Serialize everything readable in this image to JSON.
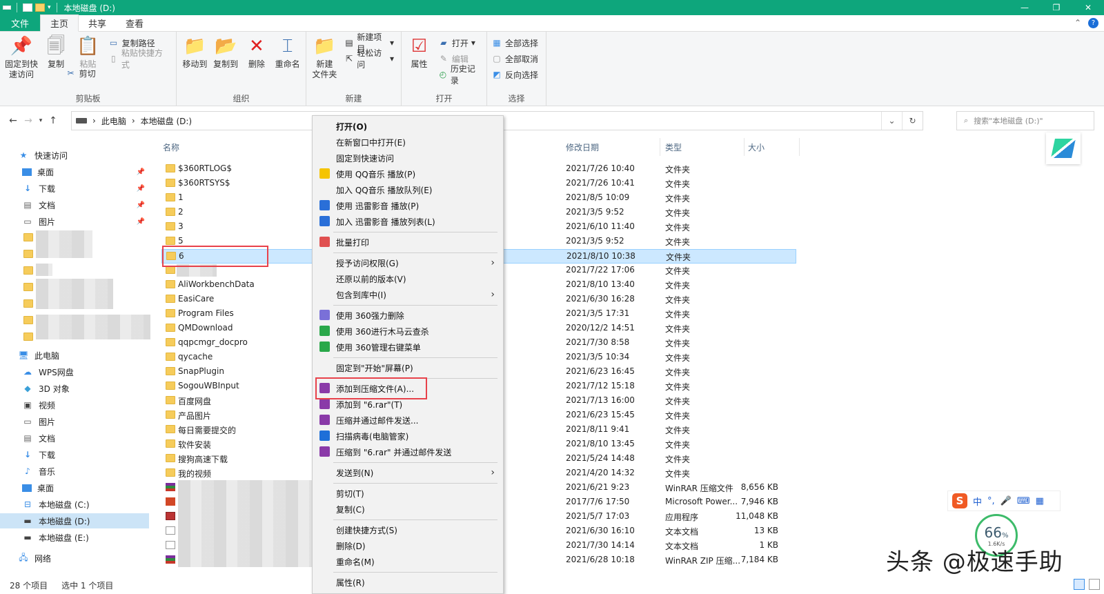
{
  "window": {
    "title": "本地磁盘 (D:)"
  },
  "ribbon_tabs": [
    "文件",
    "主页",
    "共享",
    "查看"
  ],
  "ribbon": {
    "clipboard": {
      "label": "剪贴板",
      "pin": "固定到快\n速访问",
      "copy": "复制",
      "paste": "粘贴",
      "copy_path": "复制路径",
      "paste_shortcut": "粘贴快捷方式",
      "cut": "剪切"
    },
    "organize": {
      "label": "组织",
      "move_to": "移动到",
      "copy_to": "复制到",
      "delete": "删除",
      "rename": "重命名"
    },
    "new": {
      "label": "新建",
      "new_folder": "新建\n文件夹",
      "new_item": "新建项目",
      "easy_access": "轻松访问"
    },
    "open": {
      "label": "打开",
      "properties": "属性",
      "open": "打开",
      "edit": "编辑",
      "history": "历史记录"
    },
    "select": {
      "label": "选择",
      "select_all": "全部选择",
      "select_none": "全部取消",
      "invert": "反向选择"
    }
  },
  "address": {
    "crumbs": [
      "此电脑",
      "本地磁盘 (D:)"
    ],
    "search_placeholder": "搜索\"本地磁盘 (D:)\""
  },
  "sidebar": {
    "quick_access": "快速访问",
    "quick_items": [
      "桌面",
      "下载",
      "文档",
      "图片"
    ],
    "this_pc": "此电脑",
    "pc_items": [
      "WPS网盘",
      "3D 对象",
      "视频",
      "图片",
      "文档",
      "下载",
      "音乐",
      "桌面",
      "本地磁盘 (C:)",
      "本地磁盘 (D:)",
      "本地磁盘 (E:)"
    ],
    "network": "网络"
  },
  "columns": {
    "name": "名称",
    "date": "修改日期",
    "type": "类型",
    "size": "大小"
  },
  "files": [
    {
      "name": "$360RTLOG$",
      "date": "2021/7/26 10:40",
      "type": "文件夹",
      "size": "",
      "icon": "folder"
    },
    {
      "name": "$360RTSYS$",
      "date": "2021/7/26 10:41",
      "type": "文件夹",
      "size": "",
      "icon": "folder"
    },
    {
      "name": "1",
      "date": "2021/8/5 10:09",
      "type": "文件夹",
      "size": "",
      "icon": "folder"
    },
    {
      "name": "2",
      "date": "2021/3/5 9:52",
      "type": "文件夹",
      "size": "",
      "icon": "folder"
    },
    {
      "name": "3",
      "date": "2021/6/10 11:40",
      "type": "文件夹",
      "size": "",
      "icon": "folder"
    },
    {
      "name": "5",
      "date": "2021/3/5 9:52",
      "type": "文件夹",
      "size": "",
      "icon": "folder"
    },
    {
      "name": "6",
      "date": "2021/8/10 10:38",
      "type": "文件夹",
      "size": "",
      "icon": "folder"
    },
    {
      "name": "",
      "date": "2021/7/22 17:06",
      "type": "文件夹",
      "size": "",
      "icon": "folder"
    },
    {
      "name": "AliWorkbenchData",
      "date": "2021/8/10 13:40",
      "type": "文件夹",
      "size": "",
      "icon": "folder"
    },
    {
      "name": "EasiCare",
      "date": "2021/6/30 16:28",
      "type": "文件夹",
      "size": "",
      "icon": "folder"
    },
    {
      "name": "Program Files",
      "date": "2021/3/5 17:31",
      "type": "文件夹",
      "size": "",
      "icon": "folder"
    },
    {
      "name": "QMDownload",
      "date": "2020/12/2 14:51",
      "type": "文件夹",
      "size": "",
      "icon": "folder"
    },
    {
      "name": "qqpcmgr_docpro",
      "date": "2021/7/30 8:58",
      "type": "文件夹",
      "size": "",
      "icon": "folder"
    },
    {
      "name": "qycache",
      "date": "2021/3/5 10:34",
      "type": "文件夹",
      "size": "",
      "icon": "folder"
    },
    {
      "name": "SnapPlugin",
      "date": "2021/6/23 16:45",
      "type": "文件夹",
      "size": "",
      "icon": "folder"
    },
    {
      "name": "SogouWBInput",
      "date": "2021/7/12 15:18",
      "type": "文件夹",
      "size": "",
      "icon": "folder"
    },
    {
      "name": "百度网盘",
      "date": "2021/7/13 16:00",
      "type": "文件夹",
      "size": "",
      "icon": "folder"
    },
    {
      "name": "产品图片",
      "date": "2021/6/23 15:45",
      "type": "文件夹",
      "size": "",
      "icon": "folder"
    },
    {
      "name": "每日需要提交的",
      "date": "2021/8/11 9:41",
      "type": "文件夹",
      "size": "",
      "icon": "folder"
    },
    {
      "name": "软件安装",
      "date": "2021/8/10 13:45",
      "type": "文件夹",
      "size": "",
      "icon": "folder"
    },
    {
      "name": "搜狗高速下载",
      "date": "2021/5/24 14:48",
      "type": "文件夹",
      "size": "",
      "icon": "folder"
    },
    {
      "name": "我的视频",
      "date": "2021/4/20 14:32",
      "type": "文件夹",
      "size": "",
      "icon": "folder"
    },
    {
      "name": "",
      "date": "2021/6/21 9:23",
      "type": "WinRAR 压缩文件",
      "size": "8,656 KB",
      "icon": "rar"
    },
    {
      "name": "",
      "date": "2017/7/6 17:50",
      "type": "Microsoft Power...",
      "size": "7,946 KB",
      "icon": "ppt"
    },
    {
      "name": "",
      "date": "2021/5/7 17:03",
      "type": "应用程序",
      "size": "11,048 KB",
      "icon": "exe"
    },
    {
      "name": "",
      "date": "2021/6/30 16:10",
      "type": "文本文档",
      "size": "13 KB",
      "icon": "txt"
    },
    {
      "name": "",
      "date": "2021/7/30 14:14",
      "type": "文本文档",
      "size": "1 KB",
      "icon": "txt"
    },
    {
      "name": "",
      "date": "2021/6/28 10:18",
      "type": "WinRAR ZIP 压缩...",
      "size": "7,184 KB",
      "icon": "rar"
    }
  ],
  "context_menu": [
    {
      "label": "打开(O)",
      "bold": true
    },
    {
      "label": "在新窗口中打开(E)"
    },
    {
      "label": "固定到快速访问"
    },
    {
      "label": "使用 QQ音乐 播放(P)",
      "icon": "qqmusic"
    },
    {
      "label": "加入 QQ音乐 播放队列(E)"
    },
    {
      "label": "使用 迅雷影音 播放(P)",
      "icon": "xunlei"
    },
    {
      "label": "加入 迅雷影音 播放列表(L)",
      "icon": "xunlei"
    },
    {
      "sep": true
    },
    {
      "label": "批量打印",
      "icon": "print"
    },
    {
      "sep": true
    },
    {
      "label": "授予访问权限(G)",
      "sub": true
    },
    {
      "label": "还原以前的版本(V)"
    },
    {
      "label": "包含到库中(I)",
      "sub": true
    },
    {
      "sep": true
    },
    {
      "label": "使用 360强力删除",
      "icon": "360del"
    },
    {
      "label": "使用 360进行木马云查杀",
      "icon": "360"
    },
    {
      "label": "使用 360管理右键菜单",
      "icon": "360"
    },
    {
      "sep": true
    },
    {
      "label": "固定到\"开始\"屏幕(P)"
    },
    {
      "sep": true
    },
    {
      "label": "添加到压缩文件(A)...",
      "icon": "rar"
    },
    {
      "label": "添加到 \"6.rar\"(T)",
      "icon": "rar"
    },
    {
      "label": "压缩并通过邮件发送...",
      "icon": "rar"
    },
    {
      "label": "扫描病毒(电脑管家)",
      "icon": "shield"
    },
    {
      "label": "压缩到 \"6.rar\" 并通过邮件发送",
      "icon": "rar"
    },
    {
      "sep": true
    },
    {
      "label": "发送到(N)",
      "sub": true
    },
    {
      "sep": true
    },
    {
      "label": "剪切(T)"
    },
    {
      "label": "复制(C)"
    },
    {
      "sep": true
    },
    {
      "label": "创建快捷方式(S)"
    },
    {
      "label": "删除(D)"
    },
    {
      "label": "重命名(M)"
    },
    {
      "sep": true
    },
    {
      "label": "属性(R)"
    }
  ],
  "status": {
    "count": "28 个项目",
    "selected": "选中 1 个项目"
  },
  "ime": {
    "mode": "中",
    "punct": "°,"
  },
  "gauge": {
    "percent": "66",
    "unit": "%",
    "speed": "1.6K/s"
  },
  "watermark": "头条 @极速手助",
  "colors": {
    "titlebar": "#0ea67c",
    "selection": "#cce8ff",
    "highlight_box": "#e8414a"
  }
}
